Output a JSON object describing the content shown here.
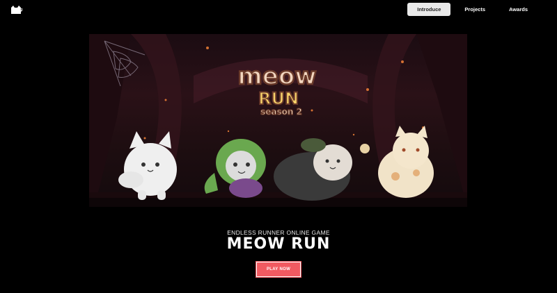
{
  "nav": {
    "logo_icon": "cat-head-icon",
    "items": [
      {
        "label": "Introduce",
        "active": true
      },
      {
        "label": "Projects",
        "active": false
      },
      {
        "label": "Awards",
        "active": false
      }
    ]
  },
  "hero": {
    "logo": {
      "line1": "meow",
      "line2": "RUN",
      "line3": "season 2"
    },
    "characters": [
      "white-cat",
      "dinosaur-costume-cat",
      "persian-cat",
      "lucky-cat"
    ]
  },
  "game": {
    "subtitle": "ENDLESS RUNNER ONLINE GAME",
    "title": "MEOW RUN",
    "cta_label": "PLAY NOW"
  },
  "colors": {
    "accent": "#f15a61",
    "nav_active_bg": "#e9e9e9",
    "background": "#000000"
  }
}
